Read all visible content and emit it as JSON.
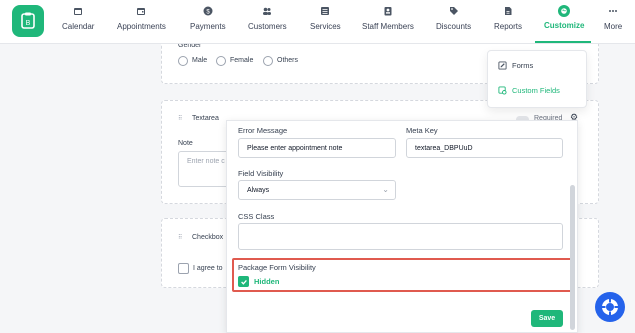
{
  "nav": {
    "items": [
      {
        "label": "Calendar",
        "icon": "calendar-icon"
      },
      {
        "label": "Appointments",
        "icon": "calendar-check-icon"
      },
      {
        "label": "Payments",
        "icon": "dollar-icon"
      },
      {
        "label": "Customers",
        "icon": "users-icon"
      },
      {
        "label": "Services",
        "icon": "grid-icon"
      },
      {
        "label": "Staff Members",
        "icon": "id-card-icon"
      },
      {
        "label": "Discounts",
        "icon": "tag-icon"
      },
      {
        "label": "Reports",
        "icon": "report-icon"
      },
      {
        "label": "Customize",
        "icon": "palette-icon",
        "active": true
      },
      {
        "label": "More",
        "icon": "dots-icon"
      }
    ]
  },
  "dropdown": {
    "forms_label": "Forms",
    "custom_fields_label": "Custom Fields"
  },
  "gender_field": {
    "label": "Gender",
    "options": [
      "Male",
      "Female",
      "Others"
    ]
  },
  "textarea_field": {
    "type_label": "Textarea",
    "required_label": "Required",
    "note_label": "Note",
    "note_placeholder": "Enter note c"
  },
  "checkbox_field": {
    "type_label": "Checkbox",
    "agree_text": "I agree to"
  },
  "settings_panel": {
    "error_message_label": "Error Message",
    "error_message_value": "Please enter appointment note",
    "meta_key_label": "Meta Key",
    "meta_key_value": "textarea_DBPUuD",
    "field_visibility_label": "Field Visibility",
    "field_visibility_value": "Always",
    "css_class_label": "CSS Class",
    "css_class_value": "",
    "package_visibility_label": "Package Form Visibility",
    "hidden_label": "Hidden",
    "hidden_checked": true,
    "save_label": "Save"
  },
  "colors": {
    "accent": "#1fb77a",
    "highlight": "#e05a4f",
    "help_button": "#2563eb"
  }
}
